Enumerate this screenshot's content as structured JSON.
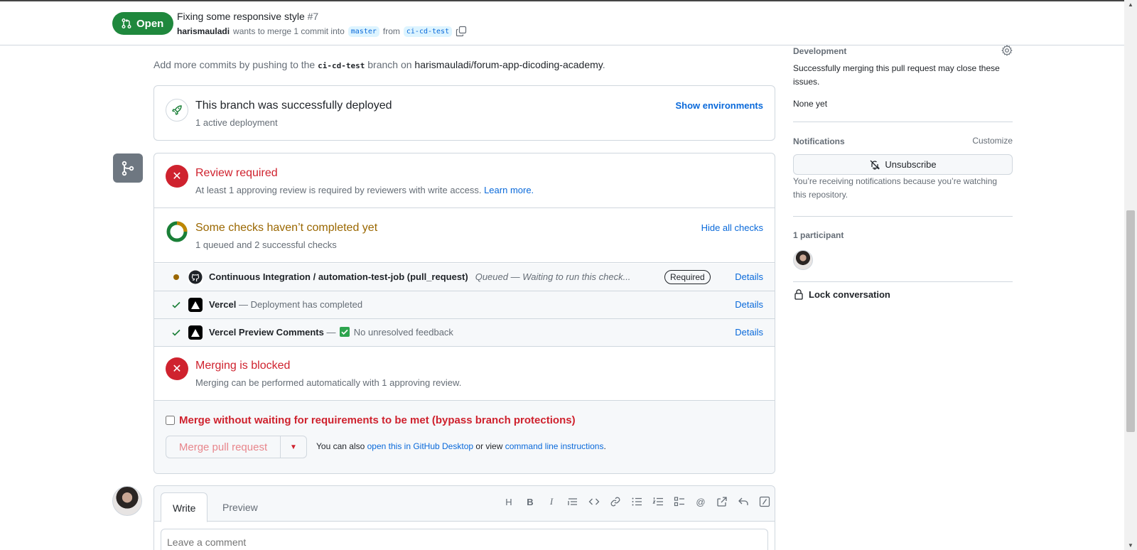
{
  "header": {
    "state": "Open",
    "title": "Fixing some responsive style",
    "number": "#7",
    "author": "harismauladi",
    "merge_text": "wants to merge 1 commit into",
    "base_branch": "master",
    "from_text": "from",
    "head_branch": "ci-cd-test"
  },
  "hint": {
    "prefix": "Add more commits by pushing to the",
    "branch": "ci-cd-test",
    "middle": "branch on",
    "repo": "harismauladi/forum-app-dicoding-academy",
    "suffix": "."
  },
  "deployment": {
    "title": "This branch was successfully deployed",
    "subtitle": "1 active deployment",
    "link": "Show environments"
  },
  "review": {
    "title": "Review required",
    "text": "At least 1 approving review is required by reviewers with write access.",
    "link": "Learn more."
  },
  "checks": {
    "title": "Some checks haven’t completed yet",
    "subtitle": "1 queued and 2 successful checks",
    "link": "Hide all checks",
    "rows": [
      {
        "name": "Continuous Integration / automation-test-job (pull_request)",
        "status": "Queued — Waiting to run this check...",
        "badge": "Required",
        "link": "Details"
      },
      {
        "name": "Vercel",
        "status": "— Deployment has completed",
        "link": "Details"
      },
      {
        "name": "Vercel Preview Comments",
        "status_prefix": "—",
        "status": "No unresolved feedback",
        "link": "Details"
      }
    ]
  },
  "blocked": {
    "title": "Merging is blocked",
    "text": "Merging can be performed automatically with 1 approving review."
  },
  "merge": {
    "bypass_label": "Merge without waiting for requirements to be met (bypass branch protections)",
    "button": "Merge pull request",
    "alt_prefix": "You can also",
    "alt_link1": "open this in GitHub Desktop",
    "alt_middle": "or view",
    "alt_link2": "command line instructions",
    "alt_suffix": "."
  },
  "composer": {
    "tab_write": "Write",
    "tab_preview": "Preview",
    "placeholder": "Leave a comment"
  },
  "sidebar": {
    "development_heading": "Development",
    "development_text": "Successfully merging this pull request may close these issues.",
    "development_none": "None yet",
    "notifications_heading": "Notifications",
    "customize": "Customize",
    "unsubscribe": "Unsubscribe",
    "notifications_text": "You’re receiving notifications because you’re watching this repository.",
    "participants_heading": "1 participant",
    "lock": "Lock conversation"
  },
  "colors": {
    "open_green": "#1f883d",
    "danger_red": "#cf222e",
    "attention_yellow": "#9a6700",
    "accent_blue": "#0969da"
  },
  "icons": [
    "git-pull-request-icon",
    "copy-icon",
    "rocket-icon",
    "git-branch-icon",
    "x-circle-icon",
    "pending-ring-icon",
    "queued-dot-icon",
    "check-icon",
    "github-app-icon",
    "vercel-icon",
    "checkbox-icon",
    "caret-down-icon",
    "gear-icon",
    "bell-slash-icon",
    "lock-icon"
  ]
}
